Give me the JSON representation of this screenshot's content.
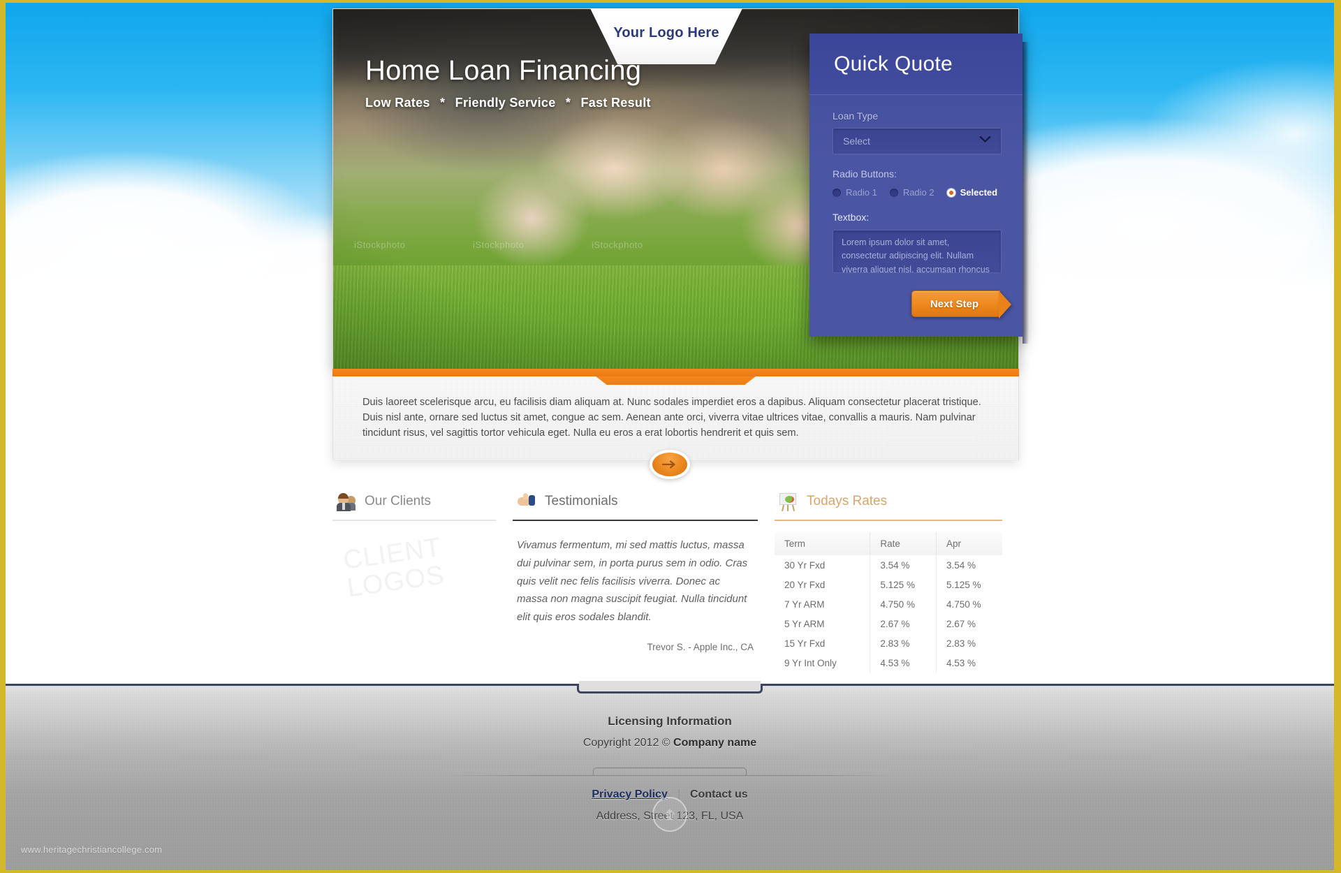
{
  "hero": {
    "logo_text": "Your Logo Here",
    "title": "Home Loan Financing",
    "tagline_1": "Low Rates",
    "tagline_star_1": "*",
    "tagline_2": "Friendly Service",
    "tagline_star_2": "*",
    "tagline_3": "Fast Result",
    "stock_watermark_1": "iStockphoto",
    "stock_watermark_2": "iStockphoto",
    "stock_watermark_3": "iStockphoto"
  },
  "quick_quote": {
    "heading": "Quick Quote",
    "loan_type_label": "Loan Type",
    "loan_type_value": "Select",
    "chevron": "❯",
    "radio_label": "Radio Buttons:",
    "radios": [
      {
        "label": "Radio 1",
        "selected": false
      },
      {
        "label": "Radio 2",
        "selected": false
      },
      {
        "label": "Selected",
        "selected": true
      }
    ],
    "textbox_label": "Textbox:",
    "textbox_value": "Lorem ipsum dolor sit amet, consectetur adipiscing elit. Nullam viverra aliquet nisl, accumsan rhoncus felis venenatis ac.",
    "next_label": "Next Step"
  },
  "intro": {
    "paragraph": "Duis laoreet scelerisque arcu, eu facilisis diam aliquam at. Nunc sodales imperdiet eros a dapibus. Aliquam consectetur placerat tristique. Duis nisl ante, ornare sed luctus sit amet, congue ac sem. Aenean ante orci, viverra vitae ultrices vitae, convallis a mauris. Nam pulvinar tincidunt risus, vel sagittis tortor vehicula eget. Nulla eu eros a erat lobortis hendrerit et quis sem."
  },
  "columns": {
    "clients": {
      "title": "Our Clients",
      "icon": "clients-icon",
      "placeholder_line_1": "CLIENT",
      "placeholder_line_2": "LOGOS"
    },
    "testimonials": {
      "title": "Testimonials",
      "icon": "thumbs-up-icon",
      "quote": "Vivamus fermentum, mi sed mattis luctus, massa dui pulvinar sem, in porta purus sem in odio. Cras quis velit nec felis facilisis viverra. Donec ac massa non magna suscipit feugiat. Nulla tincidunt elit quis eros sodales blandit.",
      "author": "Trevor S. - Apple Inc., CA"
    },
    "rates": {
      "title": "Todays Rates",
      "icon": "chart-easel-icon",
      "headers": [
        "Term",
        "Rate",
        "Apr"
      ],
      "rows": [
        [
          "30 Yr Fxd",
          "3.54 %",
          "3.54 %"
        ],
        [
          "20 Yr Fxd",
          "5.125 %",
          "5.125 %"
        ],
        [
          "7 Yr ARM",
          "4.750 %",
          "4.750 %"
        ],
        [
          "5 Yr ARM",
          "2.67 %",
          "2.67 %"
        ],
        [
          "15 Yr Fxd",
          "2.83 %",
          "2.83 %"
        ],
        [
          "9 Yr Int Only",
          "4.53 %",
          "4.53 %"
        ]
      ]
    }
  },
  "footer": {
    "licensing_title": "Licensing Information",
    "copyright_prefix": "Copyright 2012 © ",
    "company": "Company name",
    "privacy_label": "Privacy Policy",
    "link_divider": "|",
    "contact_label": "Contact us",
    "address": "Address, Street 123, FL, USA",
    "watermark": "www.heritagechristiancollege.com"
  },
  "colors": {
    "accent_orange": "#ef8a20",
    "panel_blue": "#4a55a3",
    "logo_navy": "#2b3a78",
    "frame_gold": "#d4b82a",
    "rates_accent": "#d8a66a"
  }
}
